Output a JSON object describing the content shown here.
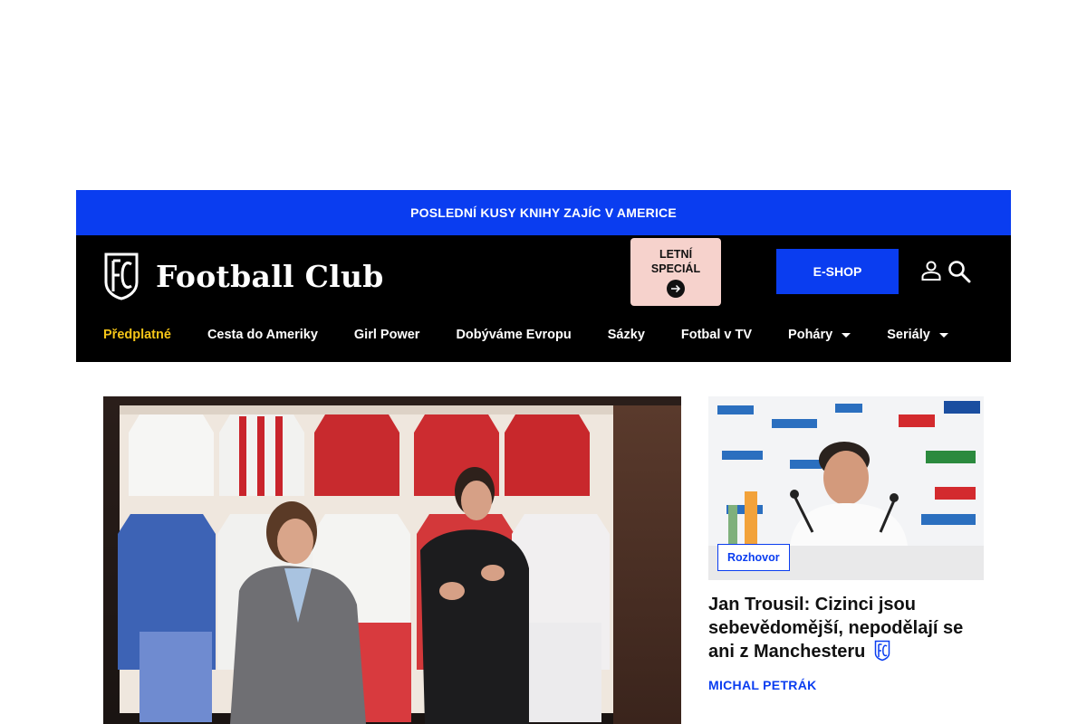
{
  "promo": {
    "text": "POSLEDNÍ KUSY KNIHY ZAJÍC V AMERICE"
  },
  "header": {
    "logo_text": "Football Club",
    "special": {
      "label": "LETNÍ\nSPECIÁL",
      "icon": "arrow-right-icon"
    },
    "eshop_label": "E-SHOP",
    "icons": [
      "user-icon",
      "search-icon"
    ]
  },
  "nav": {
    "items": [
      {
        "label": "Předplatné",
        "active": true
      },
      {
        "label": "Cesta do Ameriky"
      },
      {
        "label": "Girl Power"
      },
      {
        "label": "Dobýváme Evropu"
      },
      {
        "label": "Sázky"
      },
      {
        "label": "Fotbal v TV"
      },
      {
        "label": "Poháry",
        "dropdown": true
      },
      {
        "label": "Seriály",
        "dropdown": true
      }
    ]
  },
  "side_article": {
    "tag": "Rozhovor",
    "title": "Jan Trousil: Cizinci jsou sebevědomější, nepodělají se ani z Manchesteru",
    "author": "MICHAL PETRÁK"
  },
  "colors": {
    "brand_blue": "#0a3df0",
    "header_bg": "#000000",
    "active_nav": "#f5c518",
    "special_bg": "#f6d2cc"
  }
}
